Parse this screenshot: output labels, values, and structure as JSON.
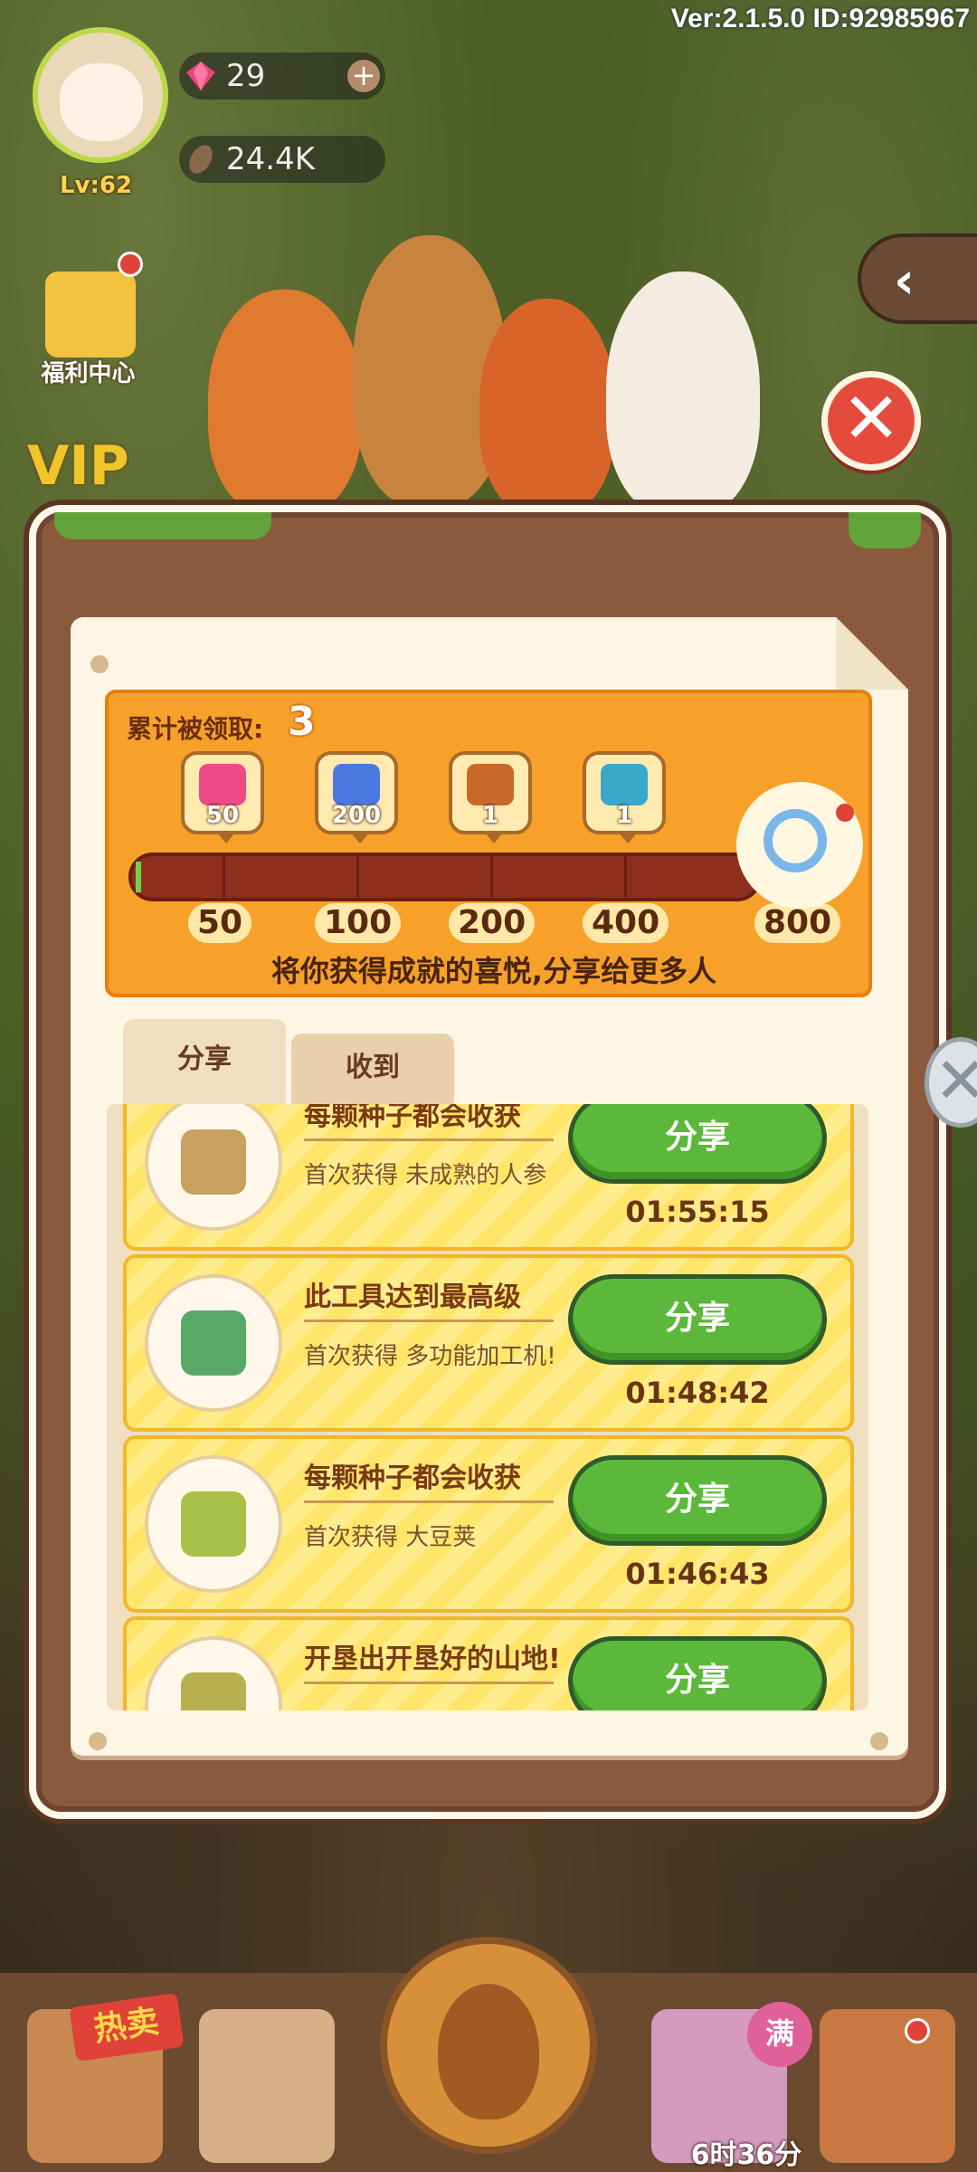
{
  "version_info": "Ver:2.1.5.0 ID:92985967",
  "player": {
    "level": "Lv:62",
    "gems": "29",
    "seeds": "24.4K"
  },
  "left_menu": {
    "welfare_label": "福利中心",
    "vip_label": "VIP"
  },
  "share_panel": {
    "total_claimed_label": "累计被领取:",
    "total_claimed_value": "3",
    "progress_value": 3,
    "rewards": [
      {
        "name": "gem",
        "count": "50",
        "color": "#ee4a86"
      },
      {
        "name": "energy",
        "count": "200",
        "color": "#4a7ae0"
      },
      {
        "name": "wooden-chest",
        "count": "1",
        "color": "#c8682a"
      },
      {
        "name": "golden-chest",
        "count": "1",
        "color": "#38a8c8"
      }
    ],
    "milestones": [
      "50",
      "100",
      "200",
      "400",
      "800"
    ],
    "share_message": "将你获得成就的喜悦,分享给更多人",
    "tabs": [
      {
        "label": "分享",
        "active": true
      },
      {
        "label": "收到",
        "active": false
      }
    ],
    "items": [
      {
        "title": "每颗种子都会收获",
        "desc": "首次获得 未成熟的人参",
        "button": "分享",
        "time": "01:55:15",
        "icon": "ginseng-icon",
        "icon_color": "#c8a060"
      },
      {
        "title": "此工具达到最高级",
        "desc": "首次获得 多功能加工机!",
        "button": "分享",
        "time": "01:48:42",
        "icon": "machine-icon",
        "icon_color": "#58a868"
      },
      {
        "title": "每颗种子都会收获",
        "desc": "首次获得 大豆荚",
        "button": "分享",
        "time": "01:46:43",
        "icon": "soybean-icon",
        "icon_color": "#a8c048"
      },
      {
        "title": "开垦出开垦好的山地!",
        "desc": "",
        "button": "分享",
        "time": "",
        "icon": "land-icon",
        "icon_color": "#b8b050"
      }
    ]
  },
  "bottom_bar": {
    "hot_sale_label": "热卖",
    "full_badge": "满",
    "timer_label": "6时36分"
  },
  "colors": {
    "accent_orange": "#f7a12a",
    "share_green": "#5bb83a",
    "panel_brown": "#8b5a3c"
  }
}
